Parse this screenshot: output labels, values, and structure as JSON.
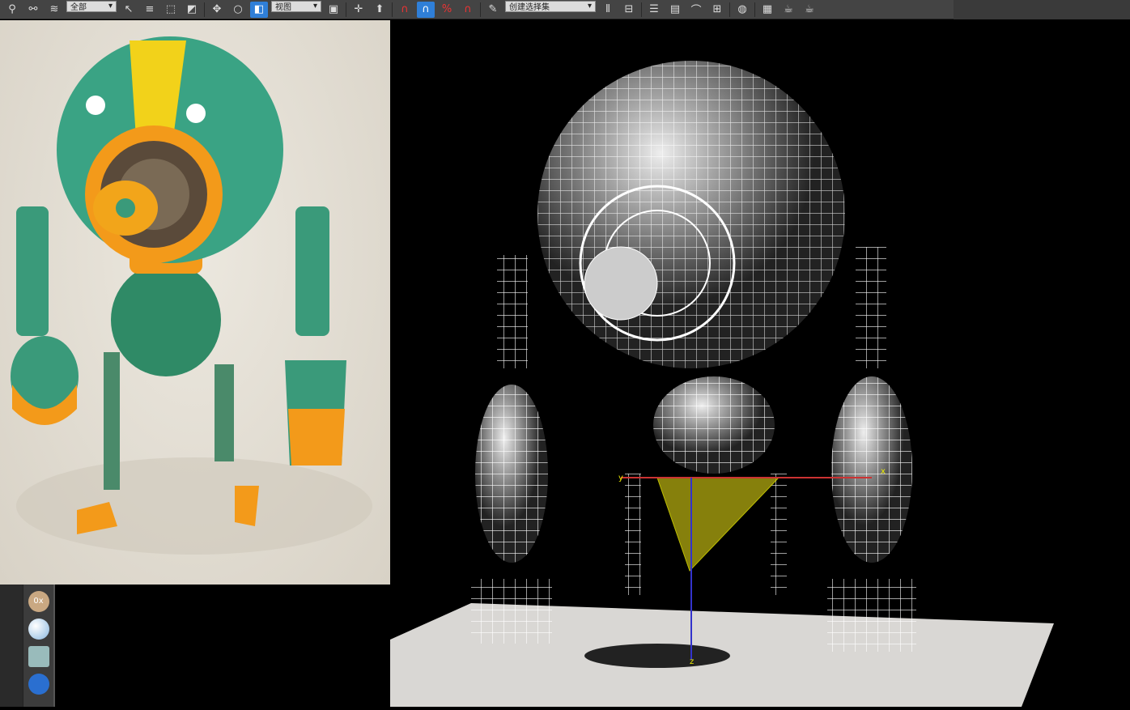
{
  "toolbar": {
    "selection_filter": "全部",
    "reference_coord": "视图",
    "named_selection": "创建选择集",
    "icons": [
      "link-icon",
      "unlink-icon",
      "bind-spacewarp-icon",
      "select-icon",
      "select-by-name-icon",
      "rect-select-icon",
      "window-crossing-icon",
      "move-icon",
      "rotate-icon",
      "scale-icon",
      "pivot-icon",
      "manipulate-icon",
      "keyboard-shortcut-icon",
      "snap-3-icon",
      "angle-snap-icon",
      "percent-snap-icon",
      "spinner-snap-icon",
      "edit-named-sets-icon",
      "mirror-icon",
      "align-icon",
      "layer-icon",
      "scene-explorer-icon",
      "curve-editor-icon",
      "schematic-view-icon",
      "material-editor-icon",
      "render-setup-icon",
      "rendered-frame-icon",
      "render-icon"
    ]
  },
  "viewport": {
    "axis_x": "x",
    "axis_y": "y",
    "axis_z": "z"
  },
  "side_panel": {
    "label": "0x"
  },
  "colors": {
    "toolbar": "#444444",
    "active": "#2f7fd8",
    "robot_green": "#3a9a7a",
    "robot_orange": "#f39a1a",
    "robot_yellow": "#f2d21a"
  }
}
